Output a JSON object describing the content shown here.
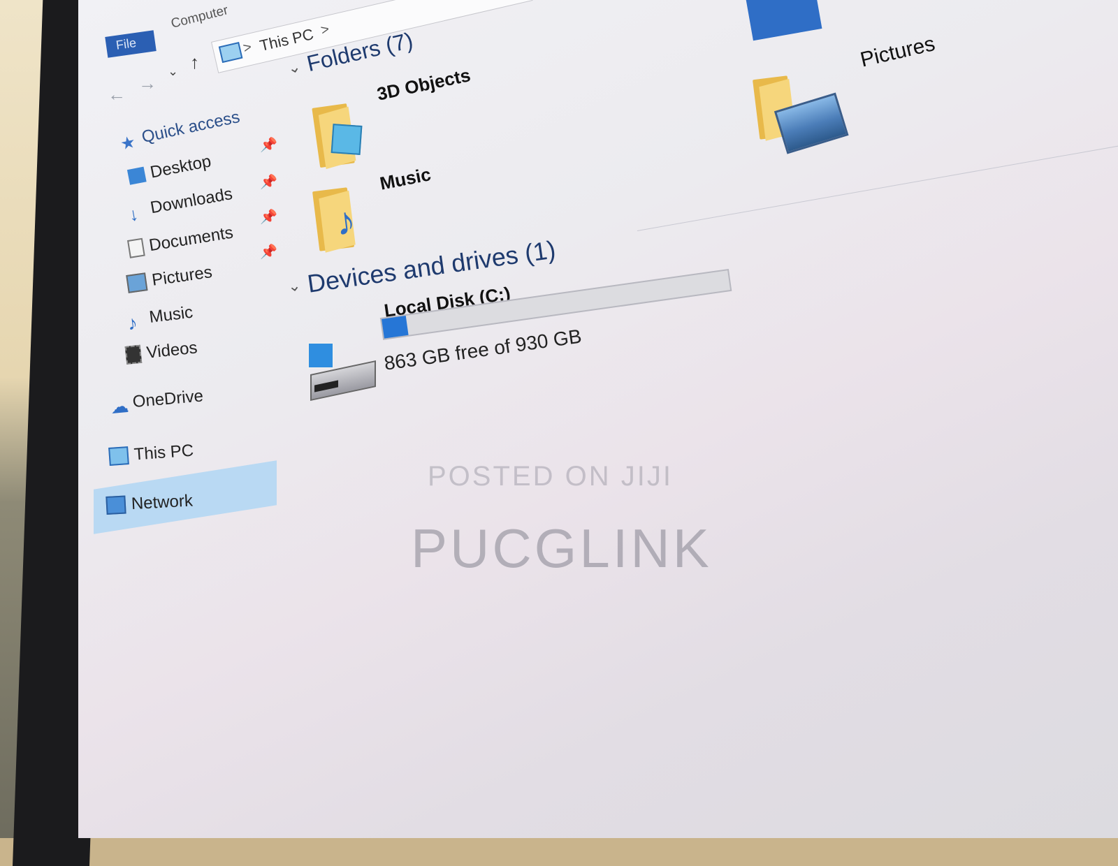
{
  "ribbon": {
    "file_tab": "File",
    "computer_tab": "Computer"
  },
  "address_bar": {
    "crumb": "This PC",
    "separator": ">"
  },
  "sidebar": {
    "quick_access": "Quick access",
    "items": [
      {
        "label": "Desktop",
        "icon": "desktop-icon",
        "pinned": true
      },
      {
        "label": "Downloads",
        "icon": "downloads-icon",
        "pinned": true
      },
      {
        "label": "Documents",
        "icon": "documents-icon",
        "pinned": true
      },
      {
        "label": "Pictures",
        "icon": "pictures-icon",
        "pinned": true
      },
      {
        "label": "Music",
        "icon": "music-icon",
        "pinned": false
      },
      {
        "label": "Videos",
        "icon": "videos-icon",
        "pinned": false
      }
    ],
    "onedrive": "OneDrive",
    "this_pc": "This PC",
    "network": "Network"
  },
  "main": {
    "folders_header": "Folders (7)",
    "folders": [
      {
        "label": "3D Objects",
        "icon": "3d-objects-icon"
      },
      {
        "label": "Music",
        "icon": "music-icon"
      },
      {
        "label": "Pictures",
        "icon": "pictures-icon"
      }
    ],
    "devices_header": "Devices and drives (1)",
    "drive": {
      "label": "Local Disk (C:)",
      "free_text": "863 GB free of 930 GB",
      "used_fraction": 0.07
    }
  },
  "watermark": {
    "line1": "POSTED ON JIJI",
    "line2": "PUCGLINK"
  },
  "colors": {
    "accent": "#2676d6",
    "selection": "#b9d9f3",
    "folder": "#e8b94a"
  }
}
